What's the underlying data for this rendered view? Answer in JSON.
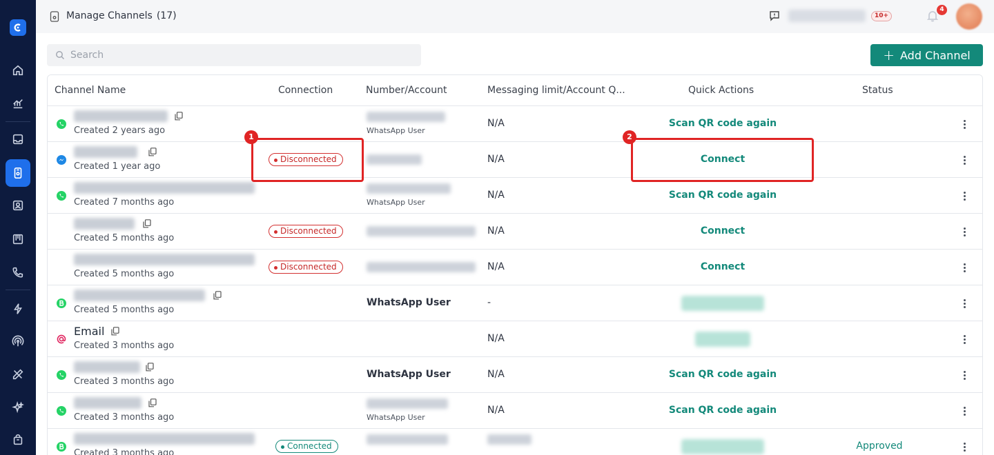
{
  "header": {
    "title": "Manage Channels",
    "count": "(17)",
    "unread_badge": "10+",
    "notification_count": "4"
  },
  "search": {
    "placeholder": "Search"
  },
  "toolbar": {
    "add_label": "Add Channel"
  },
  "table": {
    "columns": [
      "Channel Name",
      "Connection",
      "Number/Account",
      "Messaging limit/Account Q...",
      "Quick Actions",
      "Status"
    ],
    "rows": [
      {
        "icon": "whatsapp-icon",
        "name": "",
        "created": "Created 2 years ago",
        "connection": "",
        "number_sub": "WhatsApp User",
        "number": "",
        "limit": "N/A",
        "action": "Scan QR code again",
        "status": ""
      },
      {
        "icon": "messenger-icon",
        "name": "",
        "created": "Created 1 year ago",
        "connection": "Disconnected",
        "number_sub": "",
        "number": "",
        "limit": "N/A",
        "action": "Connect",
        "status": ""
      },
      {
        "icon": "whatsapp-icon",
        "name": "",
        "created": "Created 7 months ago",
        "connection": "",
        "number_sub": "WhatsApp User",
        "number": "",
        "limit": "N/A",
        "action": "Scan QR code again",
        "status": ""
      },
      {
        "icon": "",
        "name": "",
        "created": "Created 5 months ago",
        "connection": "Disconnected",
        "number_sub": "",
        "number": "",
        "limit": "N/A",
        "action": "Connect",
        "status": ""
      },
      {
        "icon": "",
        "name": "",
        "created": "Created 5 months ago",
        "connection": "Disconnected",
        "number_sub": "",
        "number": "",
        "limit": "N/A",
        "action": "Connect",
        "status": ""
      },
      {
        "icon": "whatsapp-business-icon",
        "name": "",
        "created": "Created 5 months ago",
        "connection": "",
        "number_sub": "",
        "number": "WhatsApp User",
        "limit": "-",
        "action": "",
        "status": ""
      },
      {
        "icon": "email-icon",
        "name": "Email",
        "created": "Created 3 months ago",
        "connection": "",
        "number_sub": "",
        "number": "",
        "limit": "N/A",
        "action": "",
        "status": ""
      },
      {
        "icon": "whatsapp-icon",
        "name": "",
        "created": "Created 3 months ago",
        "connection": "",
        "number_sub": "",
        "number": "WhatsApp User",
        "limit": "N/A",
        "action": "Scan QR code again",
        "status": ""
      },
      {
        "icon": "whatsapp-icon",
        "name": "",
        "created": "Created 3 months ago",
        "connection": "",
        "number_sub": "WhatsApp User",
        "number": "",
        "limit": "N/A",
        "action": "Scan QR code again",
        "status": ""
      },
      {
        "icon": "whatsapp-business-icon",
        "name": "",
        "created": "Created 3 months ago",
        "connection": "Connected",
        "number_sub": "",
        "number": "",
        "limit": "",
        "action": "",
        "status": "Approved"
      }
    ]
  },
  "annotations": [
    "1",
    "2"
  ],
  "colors": {
    "sidebar": "#0d1b3e",
    "accent": "#13897a",
    "active_nav": "#1f6feb",
    "danger": "#e02424"
  }
}
